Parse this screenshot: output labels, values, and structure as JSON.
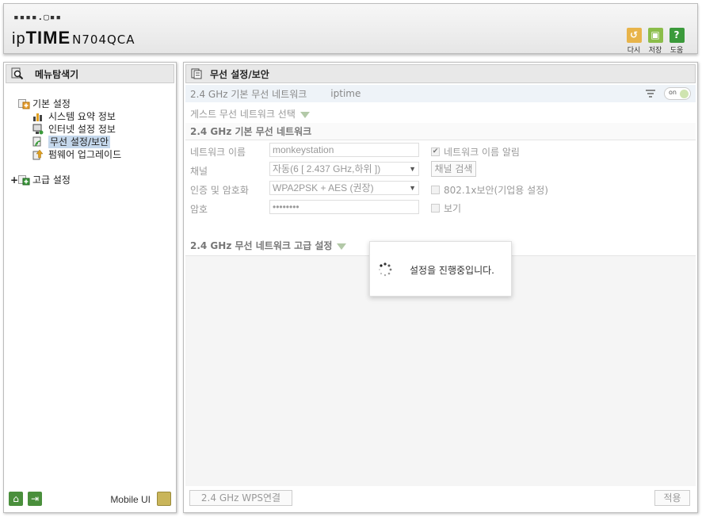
{
  "header": {
    "logo_mark": "▪▪▪▪.▢▪▪",
    "logo_ip": "ip",
    "logo_time": "TIME",
    "model": "N704QCA",
    "buttons": {
      "refresh_label": "다시",
      "save_label": "저장",
      "help_label": "도움"
    },
    "colors": {
      "refresh": "#e8b44a",
      "save": "#8bbd4a",
      "help": "#3b9a3b"
    }
  },
  "sidebar": {
    "title": "메뉴탐색기",
    "tree": {
      "basic": {
        "label": "기본 설정",
        "items": [
          {
            "label": "시스템 요약 정보",
            "icon": "chart-icon"
          },
          {
            "label": "인터넷 설정 정보",
            "icon": "monitor-icon"
          },
          {
            "label": "무선 설정/보안",
            "icon": "wireless-icon",
            "selected": true
          },
          {
            "label": "펌웨어 업그레이드",
            "icon": "upgrade-icon"
          }
        ]
      },
      "advanced": {
        "expander": "+",
        "label": "고급 설정"
      }
    },
    "footer": {
      "mobile_label": "Mobile UI"
    }
  },
  "main": {
    "title": "무선 설정/보안",
    "network_bar": {
      "band": "2.4 GHz 기본 무선 네트워크",
      "ssid": "iptime",
      "toggle": "on"
    },
    "guest_label": "게스트 무선 네트워크 선택",
    "basic_section": {
      "title": "2.4 GHz 기본 무선 네트워크",
      "network_name_label": "네트워크 이름",
      "network_name_value": "monkeystation",
      "broadcast_label": "네트워크 이름 알림",
      "broadcast_checked": true,
      "channel_label": "채널",
      "channel_value": "자동(6 [ 2.437 GHz,하위 ])",
      "channel_search_label": "채널 검색",
      "auth_label": "인증 및 암호화",
      "auth_value": "WPA2PSK + AES (권장)",
      "enterprise_label": "802.1x보안(기업용 설정)",
      "password_label": "암호",
      "password_value": "••••••••",
      "show_label": "보기"
    },
    "advanced_section": {
      "title": "2.4 GHz 무선 네트워크 고급 설정"
    },
    "wps_button": "2.4 GHz WPS연결",
    "apply_button": "적용"
  },
  "modal": {
    "message": "설정을 진행중입니다."
  }
}
